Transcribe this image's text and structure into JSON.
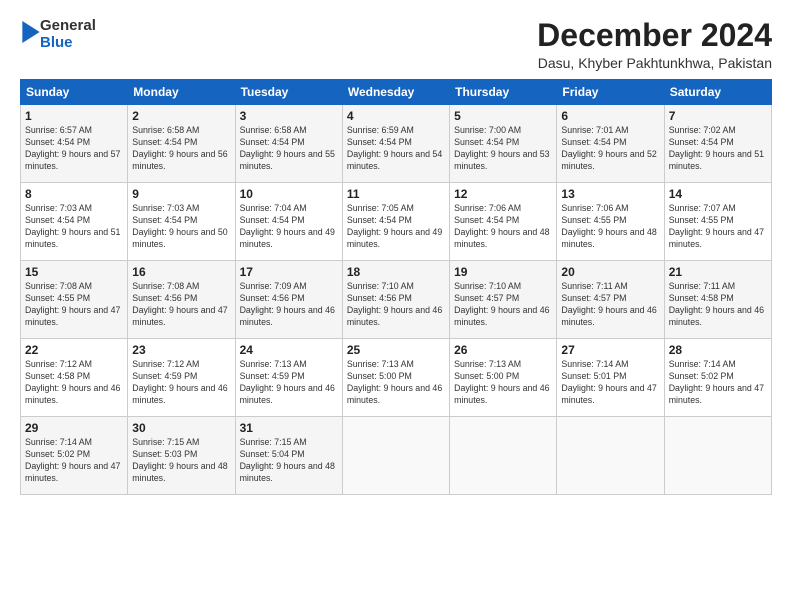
{
  "header": {
    "logo_line1": "General",
    "logo_line2": "Blue",
    "title": "December 2024",
    "subtitle": "Dasu, Khyber Pakhtunkhwa, Pakistan"
  },
  "weekdays": [
    "Sunday",
    "Monday",
    "Tuesday",
    "Wednesday",
    "Thursday",
    "Friday",
    "Saturday"
  ],
  "weeks": [
    [
      {
        "day": "1",
        "sunrise": "6:57 AM",
        "sunset": "4:54 PM",
        "daylight": "9 hours and 57 minutes."
      },
      {
        "day": "2",
        "sunrise": "6:58 AM",
        "sunset": "4:54 PM",
        "daylight": "9 hours and 56 minutes."
      },
      {
        "day": "3",
        "sunrise": "6:58 AM",
        "sunset": "4:54 PM",
        "daylight": "9 hours and 55 minutes."
      },
      {
        "day": "4",
        "sunrise": "6:59 AM",
        "sunset": "4:54 PM",
        "daylight": "9 hours and 54 minutes."
      },
      {
        "day": "5",
        "sunrise": "7:00 AM",
        "sunset": "4:54 PM",
        "daylight": "9 hours and 53 minutes."
      },
      {
        "day": "6",
        "sunrise": "7:01 AM",
        "sunset": "4:54 PM",
        "daylight": "9 hours and 52 minutes."
      },
      {
        "day": "7",
        "sunrise": "7:02 AM",
        "sunset": "4:54 PM",
        "daylight": "9 hours and 51 minutes."
      }
    ],
    [
      {
        "day": "8",
        "sunrise": "7:03 AM",
        "sunset": "4:54 PM",
        "daylight": "9 hours and 51 minutes."
      },
      {
        "day": "9",
        "sunrise": "7:03 AM",
        "sunset": "4:54 PM",
        "daylight": "9 hours and 50 minutes."
      },
      {
        "day": "10",
        "sunrise": "7:04 AM",
        "sunset": "4:54 PM",
        "daylight": "9 hours and 49 minutes."
      },
      {
        "day": "11",
        "sunrise": "7:05 AM",
        "sunset": "4:54 PM",
        "daylight": "9 hours and 49 minutes."
      },
      {
        "day": "12",
        "sunrise": "7:06 AM",
        "sunset": "4:54 PM",
        "daylight": "9 hours and 48 minutes."
      },
      {
        "day": "13",
        "sunrise": "7:06 AM",
        "sunset": "4:55 PM",
        "daylight": "9 hours and 48 minutes."
      },
      {
        "day": "14",
        "sunrise": "7:07 AM",
        "sunset": "4:55 PM",
        "daylight": "9 hours and 47 minutes."
      }
    ],
    [
      {
        "day": "15",
        "sunrise": "7:08 AM",
        "sunset": "4:55 PM",
        "daylight": "9 hours and 47 minutes."
      },
      {
        "day": "16",
        "sunrise": "7:08 AM",
        "sunset": "4:56 PM",
        "daylight": "9 hours and 47 minutes."
      },
      {
        "day": "17",
        "sunrise": "7:09 AM",
        "sunset": "4:56 PM",
        "daylight": "9 hours and 46 minutes."
      },
      {
        "day": "18",
        "sunrise": "7:10 AM",
        "sunset": "4:56 PM",
        "daylight": "9 hours and 46 minutes."
      },
      {
        "day": "19",
        "sunrise": "7:10 AM",
        "sunset": "4:57 PM",
        "daylight": "9 hours and 46 minutes."
      },
      {
        "day": "20",
        "sunrise": "7:11 AM",
        "sunset": "4:57 PM",
        "daylight": "9 hours and 46 minutes."
      },
      {
        "day": "21",
        "sunrise": "7:11 AM",
        "sunset": "4:58 PM",
        "daylight": "9 hours and 46 minutes."
      }
    ],
    [
      {
        "day": "22",
        "sunrise": "7:12 AM",
        "sunset": "4:58 PM",
        "daylight": "9 hours and 46 minutes."
      },
      {
        "day": "23",
        "sunrise": "7:12 AM",
        "sunset": "4:59 PM",
        "daylight": "9 hours and 46 minutes."
      },
      {
        "day": "24",
        "sunrise": "7:13 AM",
        "sunset": "4:59 PM",
        "daylight": "9 hours and 46 minutes."
      },
      {
        "day": "25",
        "sunrise": "7:13 AM",
        "sunset": "5:00 PM",
        "daylight": "9 hours and 46 minutes."
      },
      {
        "day": "26",
        "sunrise": "7:13 AM",
        "sunset": "5:00 PM",
        "daylight": "9 hours and 46 minutes."
      },
      {
        "day": "27",
        "sunrise": "7:14 AM",
        "sunset": "5:01 PM",
        "daylight": "9 hours and 47 minutes."
      },
      {
        "day": "28",
        "sunrise": "7:14 AM",
        "sunset": "5:02 PM",
        "daylight": "9 hours and 47 minutes."
      }
    ],
    [
      {
        "day": "29",
        "sunrise": "7:14 AM",
        "sunset": "5:02 PM",
        "daylight": "9 hours and 47 minutes."
      },
      {
        "day": "30",
        "sunrise": "7:15 AM",
        "sunset": "5:03 PM",
        "daylight": "9 hours and 48 minutes."
      },
      {
        "day": "31",
        "sunrise": "7:15 AM",
        "sunset": "5:04 PM",
        "daylight": "9 hours and 48 minutes."
      },
      null,
      null,
      null,
      null
    ]
  ]
}
